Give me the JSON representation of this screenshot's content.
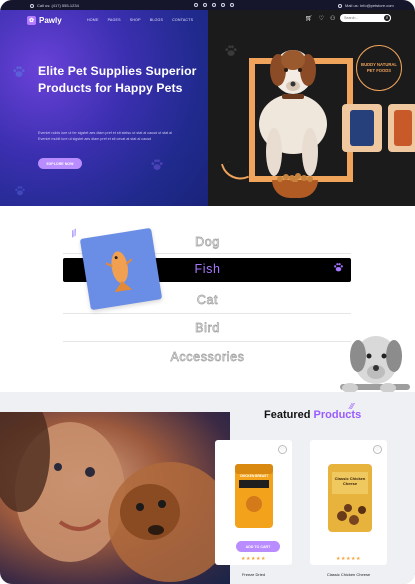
{
  "topbar": {
    "phone": "Call us: (417) 555-1234",
    "socials": [
      "facebook-icon",
      "x-icon",
      "instagram-icon",
      "youtube-icon",
      "pinterest-icon"
    ],
    "email": "Mail us: Info@petstore.com"
  },
  "brand": {
    "name": "Pawly"
  },
  "nav": [
    "HOME",
    "PAGES",
    "SHOP",
    "BLOGS",
    "CONTACTS"
  ],
  "search": {
    "placeholder": "Search..."
  },
  "hero": {
    "title": "Elite Pet Supplies Superior Products for Happy Pets",
    "description": "Eveniet nobis iure ut fer sigstet aes diam pref et sit stelsu ut stat al causd ut stat al Eveniet mubit iure ut sigstet aes diam pref et sit cevat at stat al causd",
    "cta": "EXPLORE NOW",
    "badge": "BUDDY NATURAL PET FOODS",
    "accent_color": "#b98cff",
    "frame_color": "#f0a35b"
  },
  "categories": {
    "items": [
      "Dog",
      "Fish",
      "Cat",
      "Bird",
      "Accessories"
    ],
    "active": "Fish"
  },
  "featured": {
    "title_main": "Featured",
    "title_accent": "Products",
    "products": [
      {
        "name": "Freeze Dried",
        "bag_label": "CHICKEN BREAST",
        "rating": "★★★★★",
        "button": "ADD TO CART"
      },
      {
        "name": "Classic Chicken Cheese",
        "bag_label": "Classic Chicken Cheese",
        "rating": "★★★★★"
      }
    ]
  }
}
